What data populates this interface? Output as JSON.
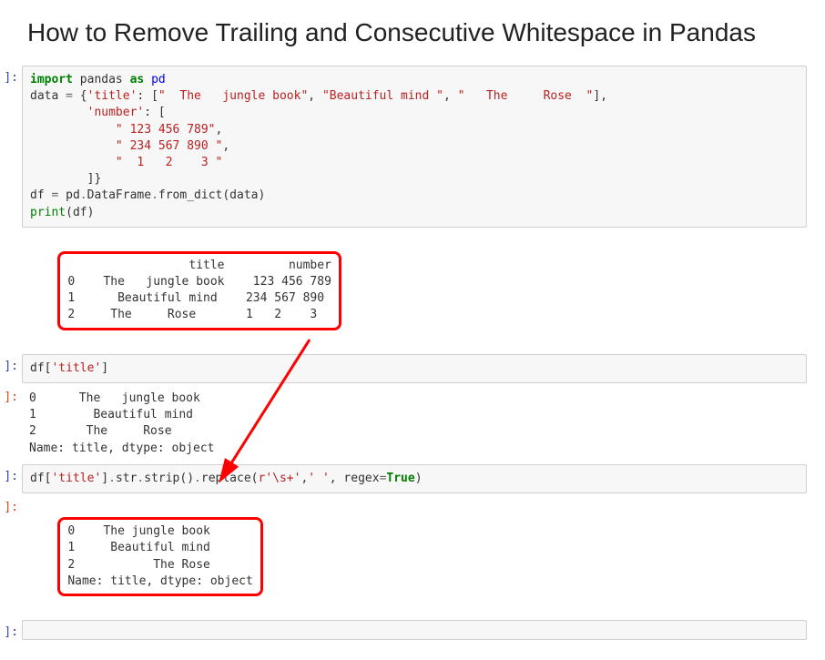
{
  "title": "How to Remove Trailing and Consecutive Whitespace in Pandas",
  "prompts": {
    "in": "]:",
    "out": "]:"
  },
  "code1": {
    "l1a": "import",
    "l1b": " pandas ",
    "l1c": "as",
    "l1d": " pd",
    "l2a": "data ",
    "l2b": "=",
    "l2c": " {",
    "l2d": "'title'",
    "l2e": ": [",
    "l2f": "\"  The   jungle book\"",
    "l2g": ", ",
    "l2h": "\"Beautiful mind \"",
    "l2i": ", ",
    "l2j": "\"   The     Rose  \"",
    "l2k": "],",
    "l3a": "        ",
    "l3b": "'number'",
    "l3c": ": [",
    "l4a": "            ",
    "l4b": "\" 123 456 789\"",
    "l4c": ",",
    "l5a": "            ",
    "l5b": "\" 234 567 890 \"",
    "l5c": ",",
    "l6a": "            ",
    "l6b": "\"  1   2    3 \"",
    "l7": "        ]}",
    "l8a": "df ",
    "l8b": "=",
    "l8c": " pd",
    "l8d": ".",
    "l8e": "DataFrame",
    "l8f": ".",
    "l8g": "from_dict",
    "l8h": "(data)",
    "l9a": "print",
    "l9b": "(df)"
  },
  "out1": "                 title         number\n0    The   jungle book    123 456 789\n1      Beautiful mind    234 567 890 \n2     The     Rose       1   2    3 ",
  "code2": {
    "a": "df[",
    "b": "'title'",
    "c": "]"
  },
  "out2": "0      The   jungle book\n1        Beautiful mind \n2       The     Rose  \nName: title, dtype: object",
  "code3": {
    "a": "df[",
    "b": "'title'",
    "c": "]",
    "d": ".",
    "e": "str",
    "f": ".",
    "g": "strip",
    "h": "()",
    "i": ".",
    "j": "replace",
    "k": "(",
    "l": "r'\\s+'",
    "m": ",",
    "n": "' '",
    "o": ", regex",
    "p": "=",
    "q": "True",
    "r": ")"
  },
  "out3": "0    The jungle book\n1     Beautiful mind\n2           The Rose\nName: title, dtype: object"
}
